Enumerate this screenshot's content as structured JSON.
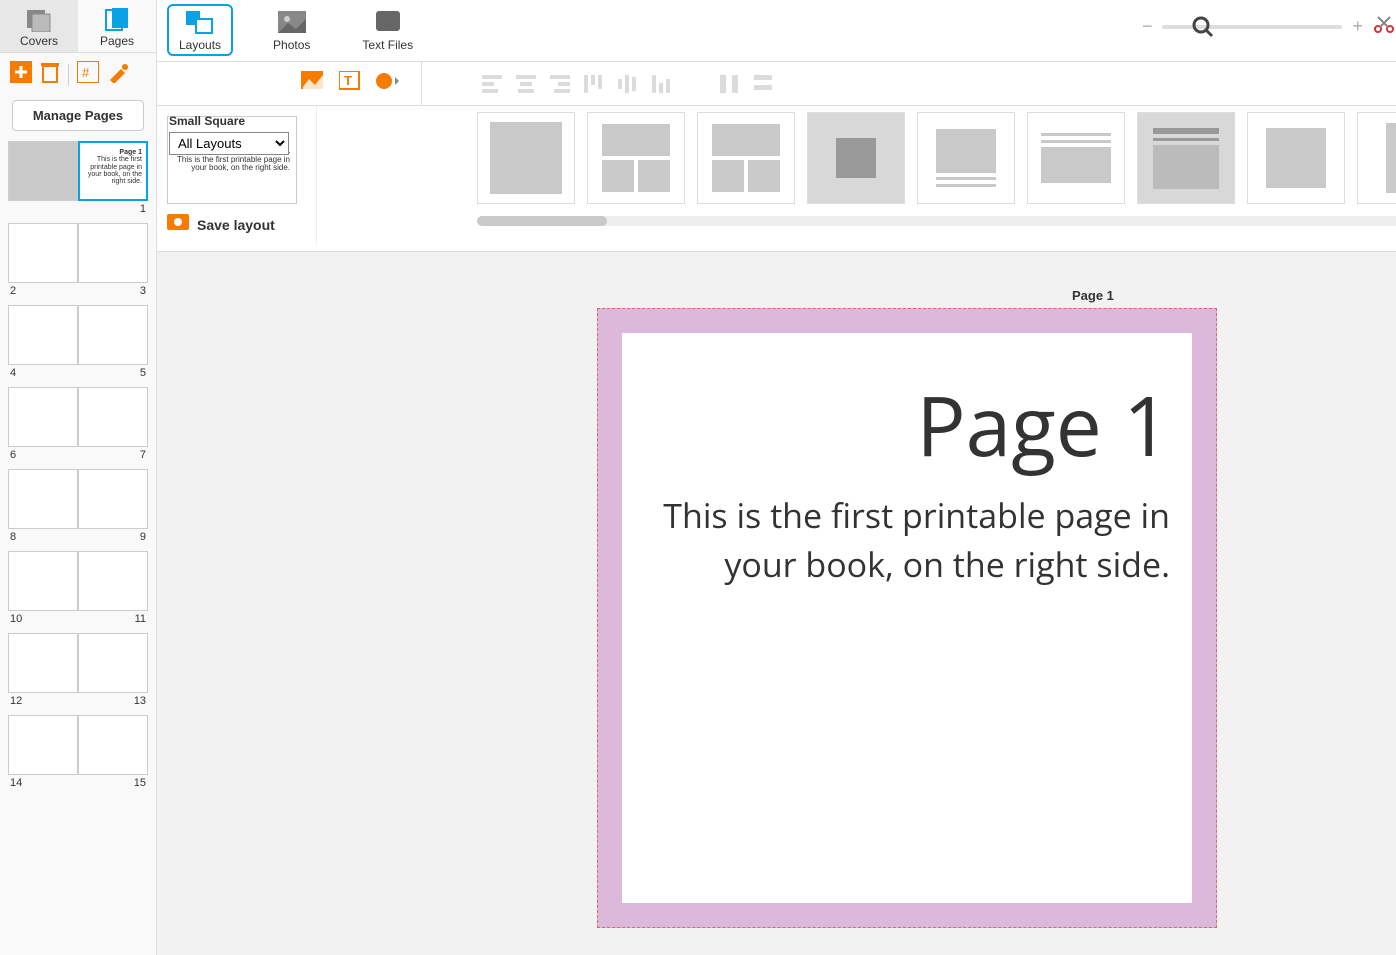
{
  "sidebar": {
    "tabs": {
      "covers": "Covers",
      "pages": "Pages"
    },
    "manage_label": "Manage Pages",
    "page_labels": [
      "1",
      "2",
      "3",
      "4",
      "5",
      "6",
      "7",
      "8",
      "9",
      "10",
      "11",
      "12",
      "13",
      "14",
      "15"
    ],
    "thumb1": {
      "title": "Page 1",
      "body": "This is the first printable page in your book, on the right side."
    }
  },
  "topbar": {
    "layouts": "Layouts",
    "photos": "Photos",
    "textfiles": "Text Files"
  },
  "layouts": {
    "category": "Small Square",
    "select": "All Layouts",
    "save_label": "Save layout"
  },
  "canvas": {
    "page_label": "Page 1",
    "heading": "Page 1",
    "body": "This is the first printable page in your book, on the right side."
  }
}
